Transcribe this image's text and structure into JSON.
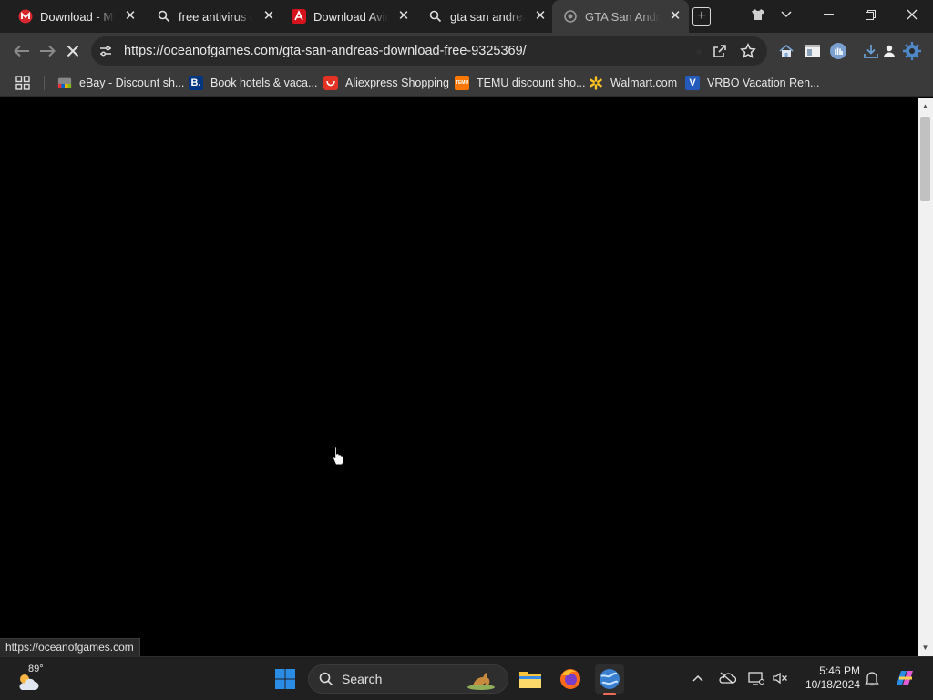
{
  "browser": {
    "tabs": [
      {
        "title": "Download - MEGA",
        "icon": "mega-icon",
        "active": false
      },
      {
        "title": "free antivirus options",
        "icon": "search-icon",
        "active": false
      },
      {
        "title": "Download Avira Free",
        "icon": "avira-icon",
        "active": false
      },
      {
        "title": "gta san andreas download",
        "icon": "search-icon",
        "active": false
      },
      {
        "title": "GTA San Andreas Download",
        "icon": "loading-spinner-icon",
        "active": true
      }
    ],
    "address": {
      "url": "https://oceanofgames.com/gta-san-andreas-download-free-9325369/"
    },
    "bookmarks": [
      {
        "label": "eBay - Discount sh...",
        "icon": "ebay-icon"
      },
      {
        "label": "Book hotels & vaca...",
        "icon": "booking-icon",
        "glyph": "B."
      },
      {
        "label": "Aliexpress Shopping",
        "icon": "aliexpress-icon"
      },
      {
        "label": "TEMU discount sho...",
        "icon": "temu-icon",
        "glyph": "TEMU"
      },
      {
        "label": "Walmart.com",
        "icon": "walmart-icon"
      },
      {
        "label": "VRBO Vacation Ren...",
        "icon": "vrbo-icon",
        "glyph": "V"
      }
    ],
    "status_url": "https://oceanofgames.com"
  },
  "taskbar": {
    "weather_temp": "89°",
    "search_label": "Search",
    "clock_time": "5:46 PM",
    "clock_date": "10/18/2024"
  },
  "colors": {
    "tab_strip": "#1f1f1f",
    "toolbar": "#3a3a3a",
    "omnibox": "#292929",
    "page": "#000000",
    "taskbar": "#202020",
    "mega_red": "#d9272e",
    "avira_red": "#d6121d",
    "walmart_yellow": "#ffc220",
    "win_blue": "#2b8ce6"
  }
}
